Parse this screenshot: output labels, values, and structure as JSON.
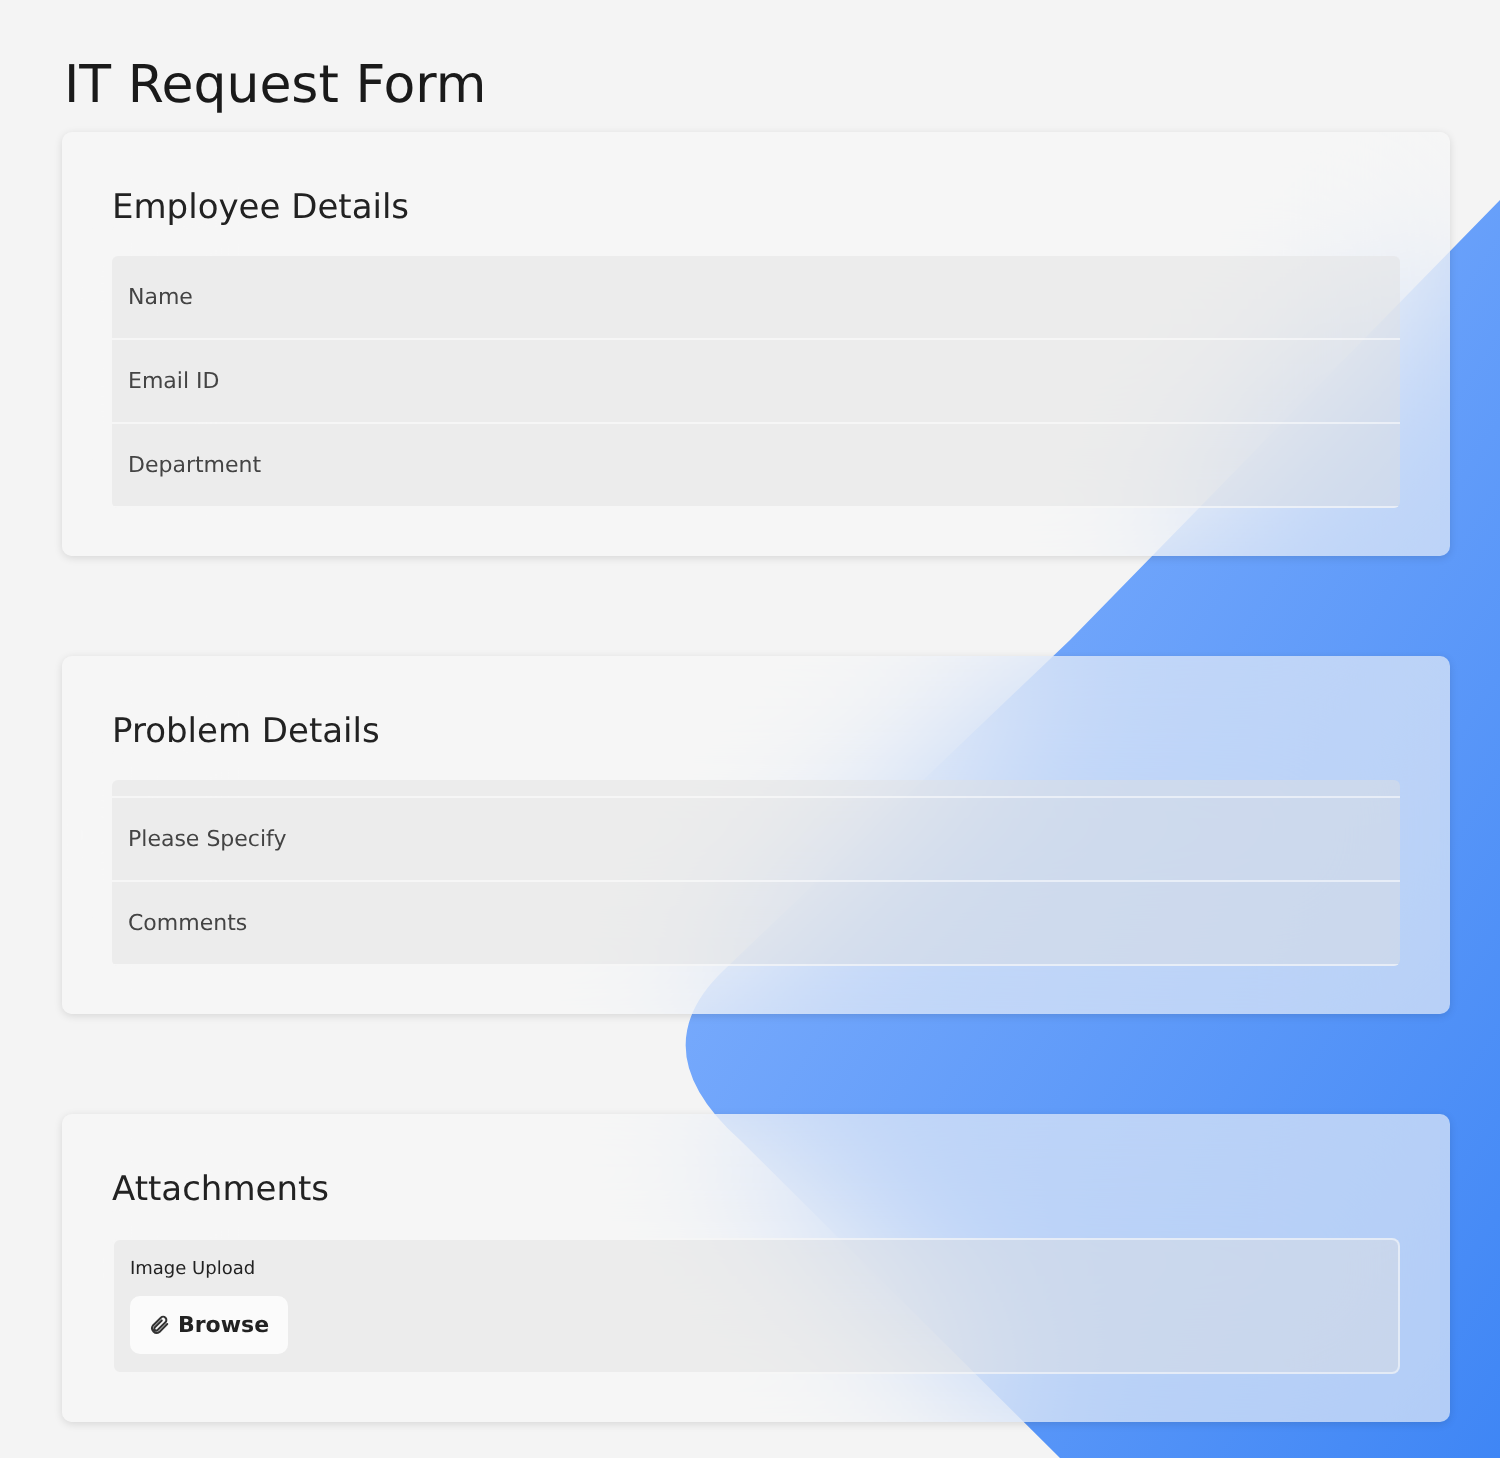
{
  "title": "IT Request Form",
  "sections": [
    {
      "kind": "fields",
      "heading": "Employee Details",
      "lead_strip": false,
      "fields": [
        {
          "placeholder": "Name"
        },
        {
          "placeholder": "Email ID"
        },
        {
          "placeholder": "Department"
        }
      ]
    },
    {
      "kind": "fields",
      "heading": "Problem Details",
      "lead_strip": true,
      "fields": [
        {
          "placeholder": "Please Specify"
        },
        {
          "placeholder": "Comments"
        }
      ]
    },
    {
      "kind": "upload",
      "heading": "Attachments",
      "label": "Image Upload",
      "button": "Browse"
    }
  ]
}
